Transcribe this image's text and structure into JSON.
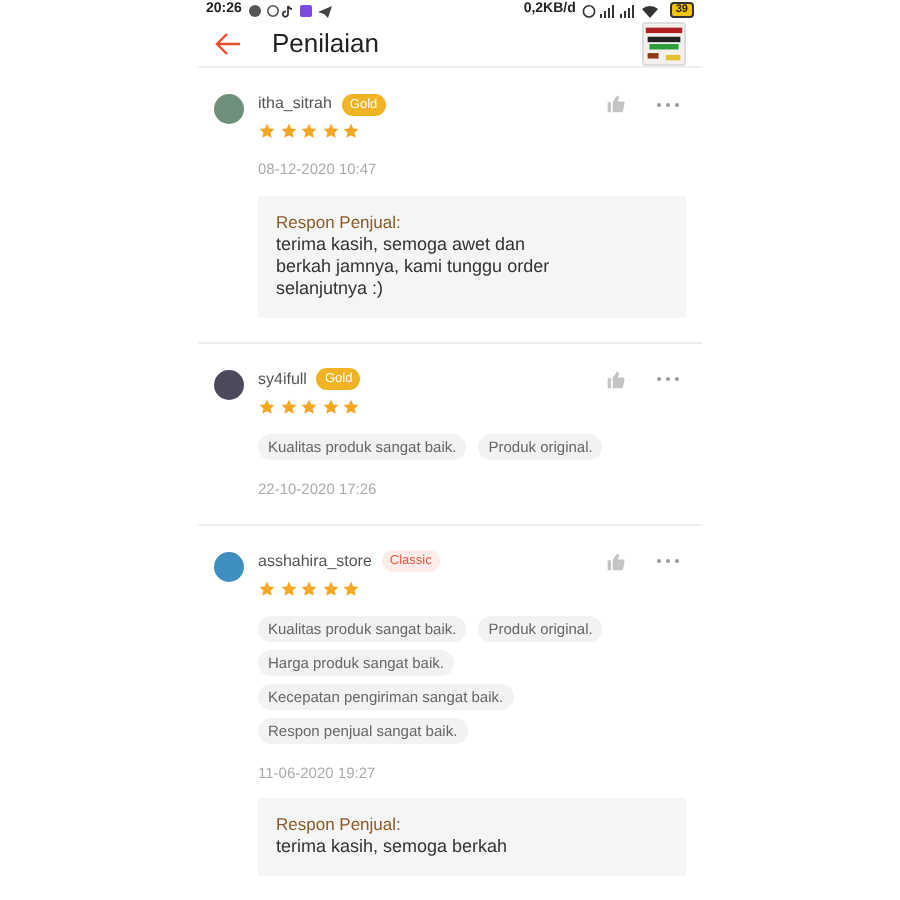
{
  "status_bar": {
    "time": "20:26",
    "speed": "0,2KB/d",
    "battery": "39"
  },
  "header": {
    "title": "Penilaian"
  },
  "reviews": [
    {
      "user": "itha_sitrah",
      "badge": {
        "label": "Gold",
        "kind": "gold"
      },
      "stars": 5,
      "date": "08-12-2020 10:47",
      "response": {
        "label": "Respon Penjual:",
        "text": "terima kasih, semoga awet dan berkah jamnya, kami tunggu order selanjutnya :)"
      }
    },
    {
      "user": "sy4ifull",
      "badge": {
        "label": "Gold",
        "kind": "gold"
      },
      "stars": 5,
      "tags": [
        "Kualitas produk sangat baik.",
        "Produk original."
      ],
      "date": "22-10-2020 17:26"
    },
    {
      "user": "asshahira_store",
      "badge": {
        "label": "Classic",
        "kind": "classic"
      },
      "stars": 5,
      "tags": [
        "Kualitas produk sangat baik.",
        "Produk original.",
        "Harga produk sangat baik.",
        "Kecepatan pengiriman sangat baik.",
        "Respon penjual sangat baik."
      ],
      "date": "11-06-2020 19:27",
      "response": {
        "label": "Respon Penjual:",
        "text": "terima kasih, semoga berkah"
      }
    }
  ]
}
